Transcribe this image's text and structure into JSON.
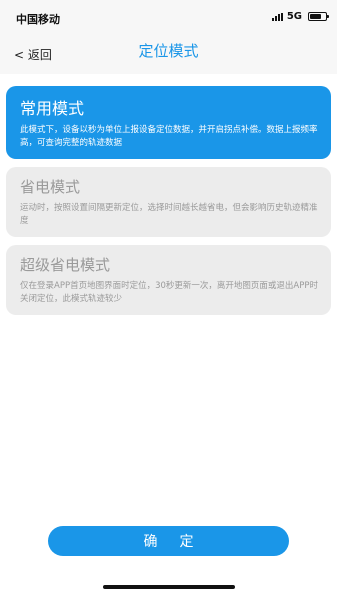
{
  "status_bar": {
    "carrier": "中国移动",
    "network": "5G",
    "battery_level": 0.7
  },
  "nav": {
    "back_label": "< 返回",
    "title": "定位模式"
  },
  "modes": [
    {
      "title": "常用模式",
      "description": "此模式下，设备以秒为单位上报设备定位数据，并开启拐点补偿。数据上报频率高，可查询完整的轨迹数据",
      "selected": true
    },
    {
      "title": "省电模式",
      "description": "运动时，按照设置间隔更新定位，选择时间越长越省电，但会影响历史轨迹精准度",
      "selected": false
    },
    {
      "title": "超级省电模式",
      "description": "仅在登录APP首页地图界面时定位，30秒更新一次，离开地图页面或退出APP时关闭定位，此模式轨迹较少",
      "selected": false
    }
  ],
  "confirm_label": "确定",
  "colors": {
    "accent": "#1a96e8",
    "card_inactive": "#ececec",
    "text_inactive": "#9a9a9a"
  }
}
